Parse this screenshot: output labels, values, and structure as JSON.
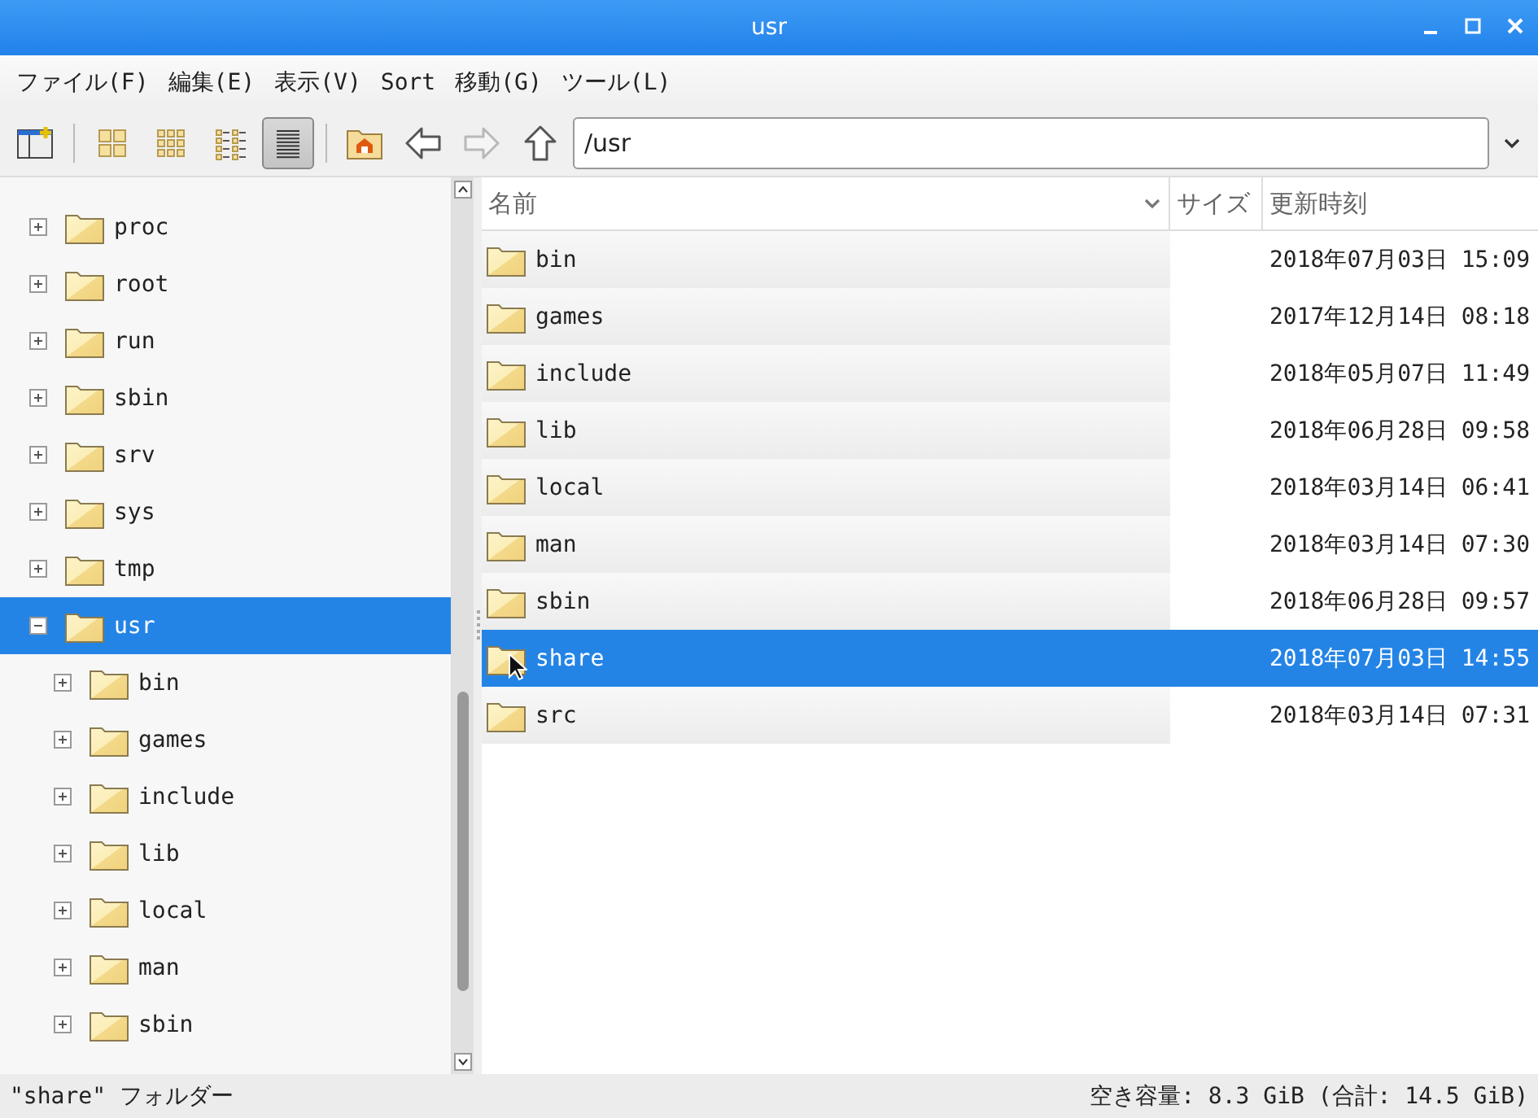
{
  "window": {
    "title": "usr"
  },
  "menu": [
    {
      "label": "ファイル(F)"
    },
    {
      "label": "編集(E)"
    },
    {
      "label": "表示(V)"
    },
    {
      "label": "Sort"
    },
    {
      "label": "移動(G)"
    },
    {
      "label": "ツール(L)"
    }
  ],
  "toolbar": {
    "view_modes": [
      {
        "kind": "icons",
        "selected": false
      },
      {
        "kind": "thumbnails",
        "selected": false
      },
      {
        "kind": "compact",
        "selected": false
      },
      {
        "kind": "list",
        "selected": true
      }
    ],
    "nav": [
      {
        "kind": "home",
        "disabled": false
      },
      {
        "kind": "back",
        "disabled": false
      },
      {
        "kind": "forward",
        "disabled": true
      },
      {
        "kind": "up",
        "disabled": false
      }
    ],
    "path": "/usr"
  },
  "tree": {
    "items": [
      {
        "label": "proc",
        "expanded": false,
        "selected": false
      },
      {
        "label": "root",
        "expanded": false,
        "selected": false
      },
      {
        "label": "run",
        "expanded": false,
        "selected": false
      },
      {
        "label": "sbin",
        "expanded": false,
        "selected": false
      },
      {
        "label": "srv",
        "expanded": false,
        "selected": false
      },
      {
        "label": "sys",
        "expanded": false,
        "selected": false
      },
      {
        "label": "tmp",
        "expanded": false,
        "selected": false
      },
      {
        "label": "usr",
        "expanded": true,
        "selected": true,
        "children": [
          {
            "label": "bin",
            "expanded": false,
            "selected": false
          },
          {
            "label": "games",
            "expanded": false,
            "selected": false
          },
          {
            "label": "include",
            "expanded": false,
            "selected": false
          },
          {
            "label": "lib",
            "expanded": false,
            "selected": false
          },
          {
            "label": "local",
            "expanded": false,
            "selected": false
          },
          {
            "label": "man",
            "expanded": false,
            "selected": false
          },
          {
            "label": "sbin",
            "expanded": false,
            "selected": false
          }
        ]
      }
    ]
  },
  "file_list": {
    "columns": [
      "名前",
      "サイズ",
      "更新時刻"
    ],
    "rows": [
      {
        "name": "bin",
        "modified": "2018年07月03日 15:09",
        "selected": false
      },
      {
        "name": "games",
        "modified": "2017年12月14日 08:18",
        "selected": false
      },
      {
        "name": "include",
        "modified": "2018年05月07日 11:49",
        "selected": false
      },
      {
        "name": "lib",
        "modified": "2018年06月28日 09:58",
        "selected": false
      },
      {
        "name": "local",
        "modified": "2018年03月14日 06:41",
        "selected": false
      },
      {
        "name": "man",
        "modified": "2018年03月14日 07:30",
        "selected": false
      },
      {
        "name": "sbin",
        "modified": "2018年06月28日 09:57",
        "selected": false
      },
      {
        "name": "share",
        "modified": "2018年07月03日 14:55",
        "selected": true
      },
      {
        "name": "src",
        "modified": "2018年03月14日 07:31",
        "selected": false
      }
    ]
  },
  "status_bar": {
    "selection": "\"share\" フォルダー",
    "space": "空き容量: 8.3 GiB (合計: 14.5 GiB)"
  }
}
